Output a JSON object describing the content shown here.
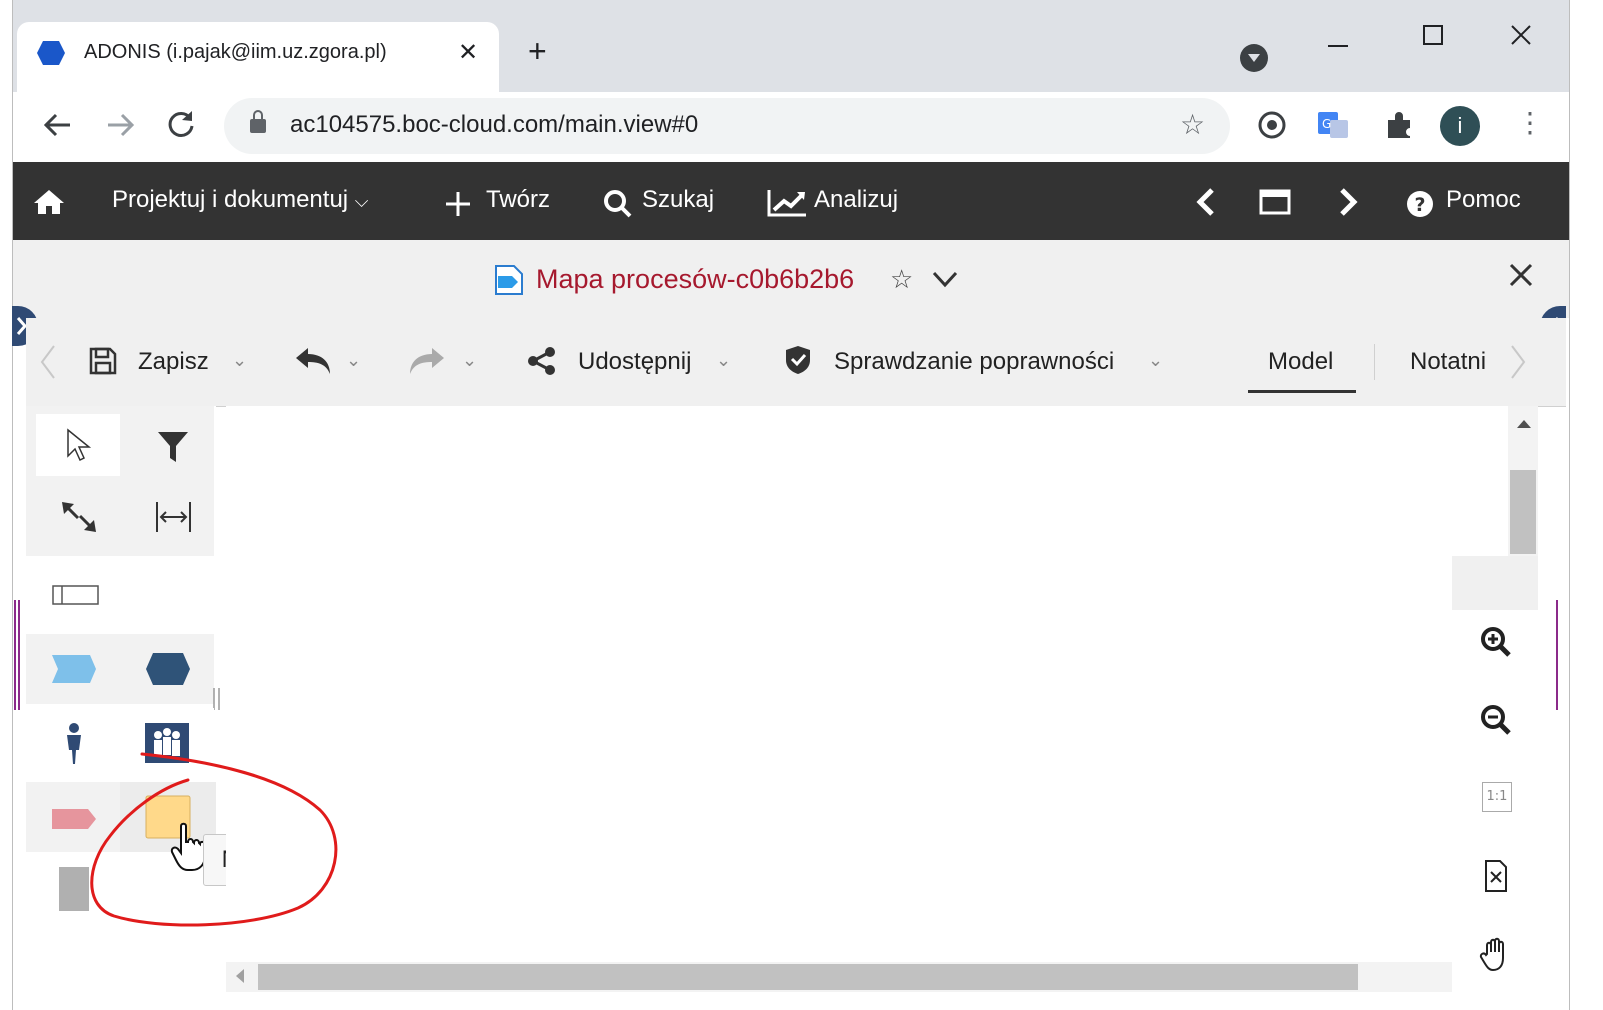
{
  "browser": {
    "tab_title": "ADONIS (i.pajak@iim.uz.zgora.pl)",
    "tab_close": "✕",
    "new_tab": "+",
    "url": "ac104575.boc-cloud.com/main.view#0",
    "profile_initial": "i"
  },
  "appbar": {
    "items": [
      {
        "label": "Projektuj i dokumentuj",
        "icon": "home-icon"
      },
      {
        "label": "Twórz",
        "icon": "plus-icon"
      },
      {
        "label": "Szukaj",
        "icon": "search-icon"
      },
      {
        "label": "Analizuj",
        "icon": "chart-icon"
      }
    ],
    "help_label": "Pomoc"
  },
  "model": {
    "title": "Mapa procesów-c0b6b2b6",
    "star": "☆"
  },
  "editor_toolbar": {
    "save_label": "Zapisz",
    "share_label": "Udostępnij",
    "validation_label": "Sprawdzanie poprawności",
    "tab_model": "Model",
    "tab_notebook": "Notatni"
  },
  "palette": {
    "tooltip": "Notka"
  },
  "zoom": {
    "one_to_one": "1:1"
  },
  "colors": {
    "appbar_bg": "#333333",
    "title_red": "#a6192e",
    "accent_blue": "#2f4a74",
    "annotation_red": "#e01b1b"
  }
}
